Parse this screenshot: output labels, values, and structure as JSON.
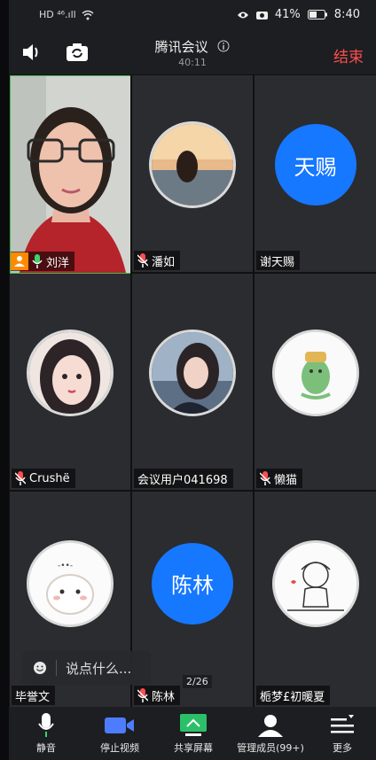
{
  "status": {
    "left": "HD ⁴⁶.ıll",
    "battery": "41%",
    "time": "8:40"
  },
  "meeting": {
    "title": "腾讯会议",
    "duration": "40:11",
    "end_label": "结束"
  },
  "participants": [
    {
      "name": "刘洋",
      "type": "video"
    },
    {
      "name": "潘如",
      "type": "photo"
    },
    {
      "name": "谢天赐",
      "type": "initials",
      "initials": "天赐"
    },
    {
      "name": "Crushë",
      "type": "photo"
    },
    {
      "name": "会议用户041698",
      "type": "photo"
    },
    {
      "name": "懒猫",
      "type": "photo"
    },
    {
      "name": "毕誉文",
      "type": "photo"
    },
    {
      "name": "陈林",
      "type": "initials",
      "initials": "陈林"
    },
    {
      "name": "栀梦£初暖夏",
      "type": "photo"
    }
  ],
  "chat": {
    "placeholder": "说点什么..."
  },
  "pagination": "2/26",
  "toolbar": {
    "mute": "静音",
    "stop_video": "停止视频",
    "share_screen": "共享屏幕",
    "manage_members": "管理成员(99+)",
    "more": "更多"
  },
  "colors": {
    "accent_blue": "#1677ff",
    "end_red": "#ff4d4f",
    "mic_red": "#ff4d4f",
    "share_green": "#2bbf6a",
    "video_blue": "#4e7cff"
  }
}
